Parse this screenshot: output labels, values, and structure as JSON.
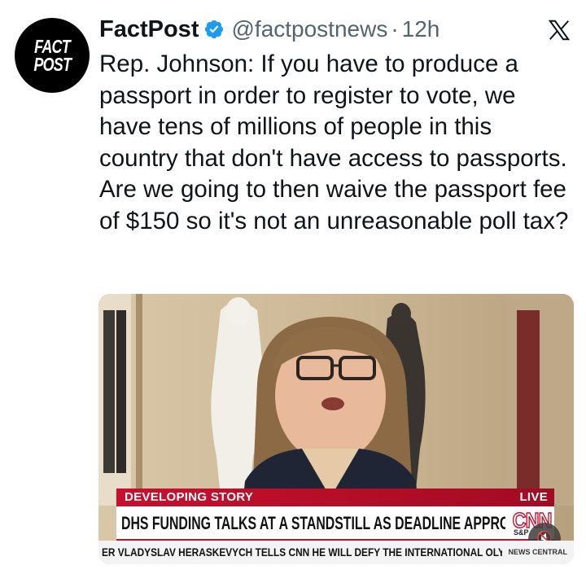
{
  "account": {
    "avatar_line1": "FACT",
    "avatar_line2": "POST",
    "name": "FactPost",
    "handle": "@factpostnews",
    "separator": "·",
    "time": "12h"
  },
  "tweet": {
    "text": "Rep. Johnson: If you have to produce a passport in order to register to vote, we have tens of millions of people in this country that don't have access to passports. Are we going to then waive the passport fee of $150 so it's not an unreasonable poll tax?"
  },
  "video": {
    "developing_label": "DEVELOPING STORY",
    "live_label": "LIVE",
    "headline": "DHS FUNDING TALKS AT A STANDSTILL AS DEADLINE APPROACHES",
    "network_logo": "CNN",
    "market_label": "S&P",
    "ticker": "ER VLADYSLAV HERASKEVYCH TELLS CNN HE WILL DEFY THE INTERNATIONAL OLYMPI",
    "ticker_network": "NEWS CENTRAL",
    "mute_glyph": "🔇",
    "colors": {
      "cnn_red": "#c8102e",
      "lower_third_bg": "#ffffff"
    }
  },
  "icons": {
    "verified": "verified-badge-icon",
    "platform": "x-logo-icon",
    "mute": "mute-icon"
  },
  "colors": {
    "verified_blue": "#1d9bf0",
    "text": "#0f1419",
    "muted_text": "#536471"
  }
}
